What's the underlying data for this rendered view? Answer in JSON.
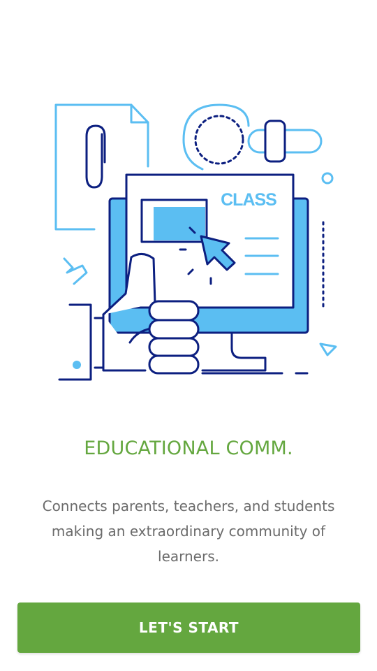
{
  "illustration": {
    "board_label": "CLASS",
    "colors": {
      "navy": "#0c1f80",
      "light_blue": "#5bbef2",
      "white": "#ffffff"
    }
  },
  "onboarding": {
    "title": "EDUCATIONAL COMM.",
    "description": "Connects parents, teachers, and students making an extraordinary community of learners.",
    "button_label": "LET'S START"
  },
  "colors": {
    "accent": "#64a73f",
    "text": "#6b6b6b",
    "background": "#ffffff"
  }
}
